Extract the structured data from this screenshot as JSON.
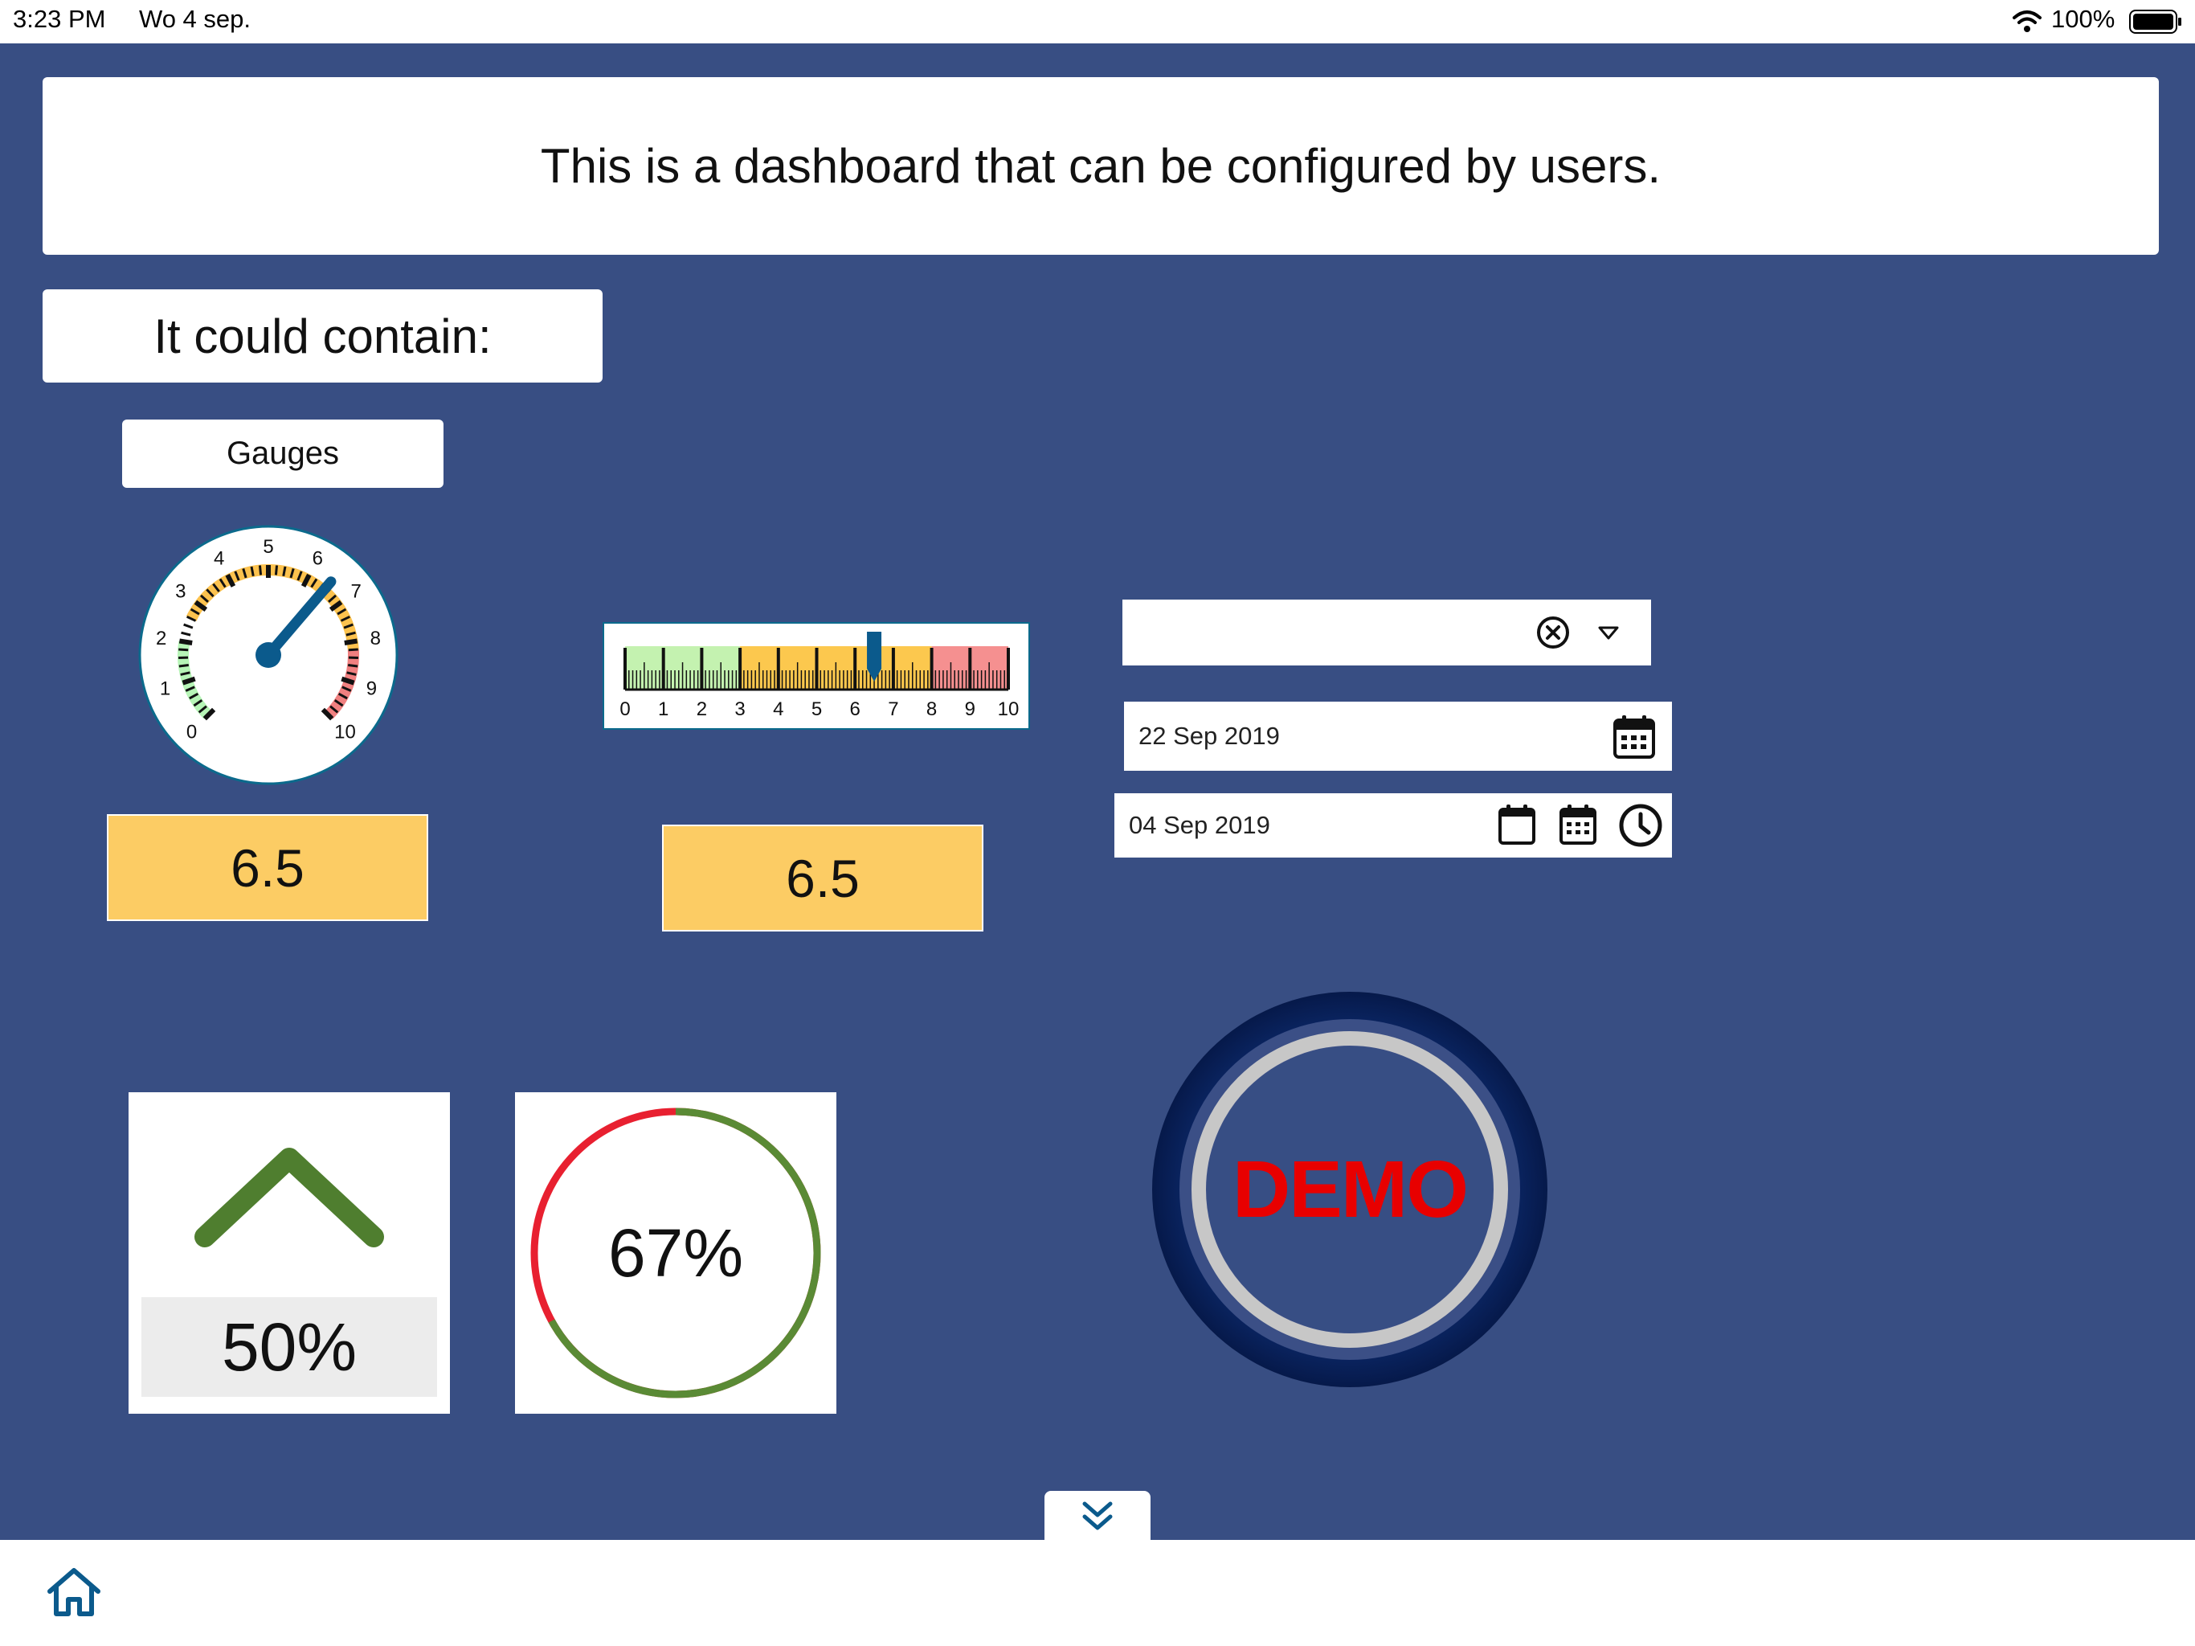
{
  "status_bar": {
    "time": "3:23 PM",
    "date": "Wo 4 sep.",
    "battery": "100%"
  },
  "header": {
    "text": "This is a dashboard that can be configured by users."
  },
  "intro": {
    "text": "It could contain:"
  },
  "gauges_label": "Gauges",
  "radial_gauge": {
    "value": 6.5,
    "min": 0,
    "max": 10,
    "ticks": [
      "0",
      "1",
      "2",
      "3",
      "4",
      "5",
      "6",
      "7",
      "8",
      "9",
      "10"
    ],
    "value_display": "6.5",
    "zone_colors": {
      "low": "#b6f5b6",
      "mid": "#fcc24e",
      "high": "#f08080"
    }
  },
  "linear_gauge": {
    "value": 6.5,
    "min": 0,
    "max": 10,
    "ticks": [
      "0",
      "1",
      "2",
      "3",
      "4",
      "5",
      "6",
      "7",
      "8",
      "9",
      "10"
    ],
    "value_display": "6.5",
    "zone_colors": {
      "low": "#c4f2b0",
      "mid": "#fcc84e",
      "high": "#f59090"
    }
  },
  "dropdown": {
    "value": "",
    "clear_icon": "clear-circle-icon",
    "arrow_icon": "chevron-down-icon"
  },
  "date_field": {
    "value": "22 Sep 2019",
    "icon": "calendar-icon"
  },
  "datetime_field": {
    "value": "04 Sep 2019",
    "icons": [
      "calendar-blank-icon",
      "calendar-icon",
      "clock-icon"
    ]
  },
  "trend_tile": {
    "value_text": "50%",
    "direction": "up",
    "color": "#4f7e2f"
  },
  "ring_tile": {
    "value_text": "67%",
    "value": 67,
    "progress_color": "#5a8a35",
    "rest_color": "#e82030"
  },
  "demo_button": {
    "label": "DEMO",
    "label_color": "#e80000"
  },
  "scroll_down_icon": "double-chevron-down-icon",
  "home_icon": "home-icon",
  "colors": {
    "background": "#384e83",
    "accent": "#0b5a8c",
    "value_box": "#fccc64"
  }
}
